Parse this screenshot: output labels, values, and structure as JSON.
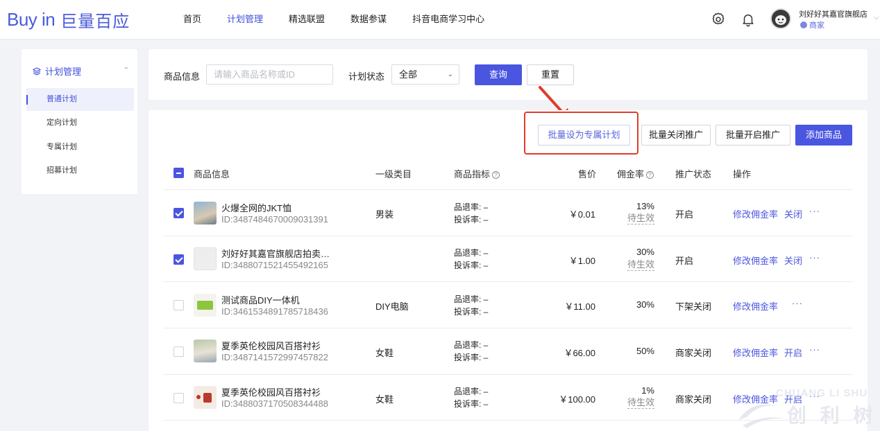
{
  "header": {
    "logo_latin": "Buy in",
    "logo_cn": "巨量百应",
    "nav": [
      "首页",
      "计划管理",
      "精选联盟",
      "数据参谋",
      "抖音电商学习中心"
    ],
    "active_nav_index": 1,
    "shop_name": "刘好好其嘉官旗舰店",
    "shop_role": "商家",
    "icons": [
      "settings-icon",
      "bell-icon",
      "avatar",
      "chevron-down-icon"
    ]
  },
  "sidebar": {
    "group_title": "计划管理",
    "items": [
      "普通计划",
      "定向计划",
      "专属计划",
      "招募计划"
    ],
    "active_index": 0
  },
  "filter": {
    "product_label": "商品信息",
    "product_placeholder": "请输入商品名称或ID",
    "status_label": "计划状态",
    "status_value": "全部",
    "query_button": "查询",
    "reset_button": "重置"
  },
  "toolbar": {
    "batch_exclusive": "批量设为专属计划",
    "batch_close": "批量关闭推广",
    "batch_open": "批量开启推广",
    "add_product": "添加商品"
  },
  "table": {
    "columns": [
      "商品信息",
      "一级类目",
      "商品指标",
      "售价",
      "佣金率",
      "推广状态",
      "操作"
    ],
    "rows": [
      {
        "name": "火爆全网的JKT恤",
        "id": "ID:3487484670009031391",
        "category": "男装",
        "return_rate": "品退率: –",
        "complaint_rate": "投诉率: –",
        "price": "￥0.01",
        "commission": "13%",
        "pending": "待生效",
        "status": "开启",
        "action1": "修改佣金率",
        "action2": "关闭",
        "more": "···",
        "checked": true
      },
      {
        "name": "刘好好其嘉官旗舰店拍卖…",
        "id": "ID:3488071521455492165",
        "category": "",
        "return_rate": "品退率: –",
        "complaint_rate": "投诉率: –",
        "price": "￥1.00",
        "commission": "30%",
        "pending": "待生效",
        "status": "开启",
        "action1": "修改佣金率",
        "action2": "关闭",
        "more": "···",
        "checked": true
      },
      {
        "name": "测试商品DIY一体机",
        "id": "ID:3461534891785718436",
        "category": "DIY电脑",
        "return_rate": "品退率: –",
        "complaint_rate": "投诉率: –",
        "price": "￥11.00",
        "commission": "30%",
        "pending": "",
        "status": "下架关闭",
        "action1": "修改佣金率",
        "action2": "",
        "more": "···",
        "checked": false
      },
      {
        "name": "夏季英伦校园风百搭衬衫",
        "id": "ID:3487141572997457822",
        "category": "女鞋",
        "return_rate": "品退率: –",
        "complaint_rate": "投诉率: –",
        "price": "￥66.00",
        "commission": "50%",
        "pending": "",
        "status": "商家关闭",
        "action1": "修改佣金率",
        "action2": "开启",
        "more": "···",
        "checked": false
      },
      {
        "name": "夏季英伦校园风百搭衬衫",
        "id": "ID:3488037170508344488",
        "category": "女鞋",
        "return_rate": "品退率: –",
        "complaint_rate": "投诉率: –",
        "price": "￥100.00",
        "commission": "1%",
        "pending": "待生效",
        "status": "商家关闭",
        "action1": "修改佣金率",
        "action2": "开启",
        "more": "···",
        "checked": false
      }
    ]
  },
  "watermark": {
    "latin": "CHUANG LI SHU",
    "cn": "创 利 树"
  },
  "colors": {
    "accent": "#4a55e0",
    "highlight": "#e03b2c"
  }
}
